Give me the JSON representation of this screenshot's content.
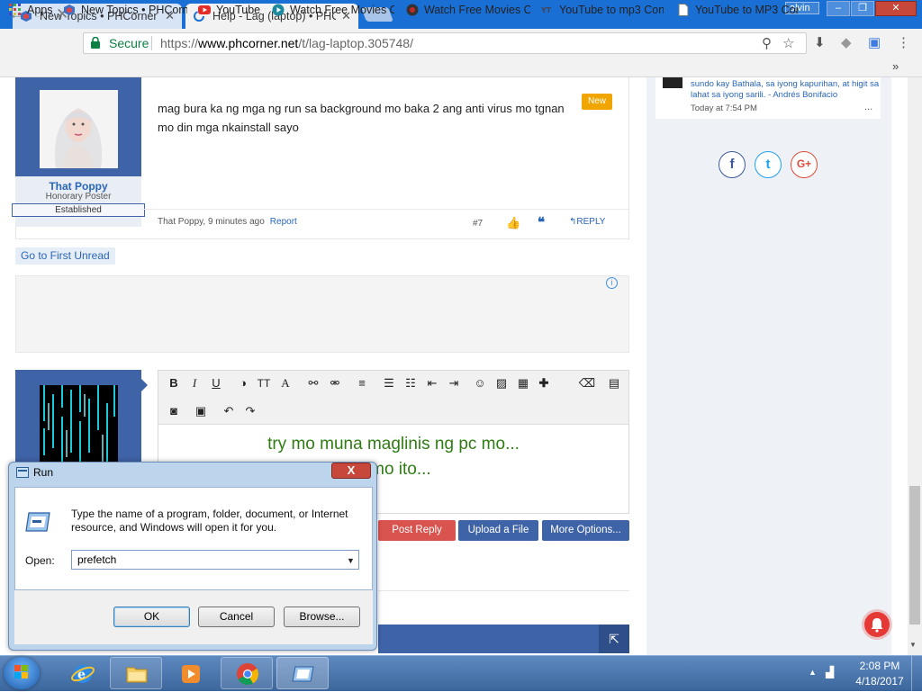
{
  "browser": {
    "tabs": [
      {
        "label": "New Topics • PHCorner"
      },
      {
        "label": "Help - Lag (laptop) • PHC"
      }
    ],
    "user": "alvin",
    "window_buttons": {
      "minimize": "–",
      "restore": "❐",
      "close": "✕"
    },
    "secure_label": "Secure",
    "url_prefix": "https://",
    "url_host": "www.phcorner.net",
    "url_path": "/t/lag-laptop.305748/",
    "bookmarks": [
      {
        "label": "Apps"
      },
      {
        "label": "New Topics • PHCorn"
      },
      {
        "label": "YouTube"
      },
      {
        "label": "Watch Free Movies Or"
      },
      {
        "label": "Watch Free Movies Or"
      },
      {
        "label": "YouTube to mp3 Con"
      },
      {
        "label": "YouTube to MP3 Con"
      }
    ],
    "bookmarks_more": "»"
  },
  "post": {
    "username": "That Poppy",
    "user_title": "Honorary Poster",
    "user_badge": "Established",
    "body": "mag bura ka ng mga ng run sa background mo baka 2 ang anti virus mo tgnan mo din mga nkainstall sayo",
    "new_badge": "New",
    "meta_author_time": "That Poppy, 9 minutes ago",
    "report_label": "Report",
    "post_number": "#7",
    "reply_label": "REPLY"
  },
  "page": {
    "first_unread_label": "Go to First Unread",
    "ad_info": "i",
    "editor_line1": "try mo muna maglinis ng pc mo...",
    "editor_line2": "n mo ito...",
    "post_reply_label": "Post Reply",
    "upload_label": "Upload a File",
    "more_options_label": "More Options..."
  },
  "sidebar": {
    "quote": "sundo kay Bathala, sa iyong kapurihan, at higit sa lahat sa iyong sarili. - Andrés Bonifacio",
    "time": "Today at 7:54 PM",
    "more": "...",
    "social": [
      {
        "label": "f",
        "color": "#3b5998"
      },
      {
        "label": "t",
        "color": "#1da1f2"
      },
      {
        "label": "G+",
        "color": "#dd4b39"
      }
    ]
  },
  "run_dialog": {
    "title": "Run",
    "close": "X",
    "description": "Type the name of a program, folder, document, or Internet resource, and Windows will open it for you.",
    "open_label": "Open:",
    "input_value": "prefetch",
    "ok_label": "OK",
    "cancel_label": "Cancel",
    "browse_label": "Browse..."
  },
  "taskbar": {
    "time": "2:08 PM",
    "date": "4/18/2017"
  },
  "colors": {
    "chrome_blue": "#1a6fd4",
    "forum_blue": "#3f63a7",
    "secure_green": "#0b8043",
    "post_reply_red": "#d9534f",
    "editor_green": "#2e7d12"
  }
}
